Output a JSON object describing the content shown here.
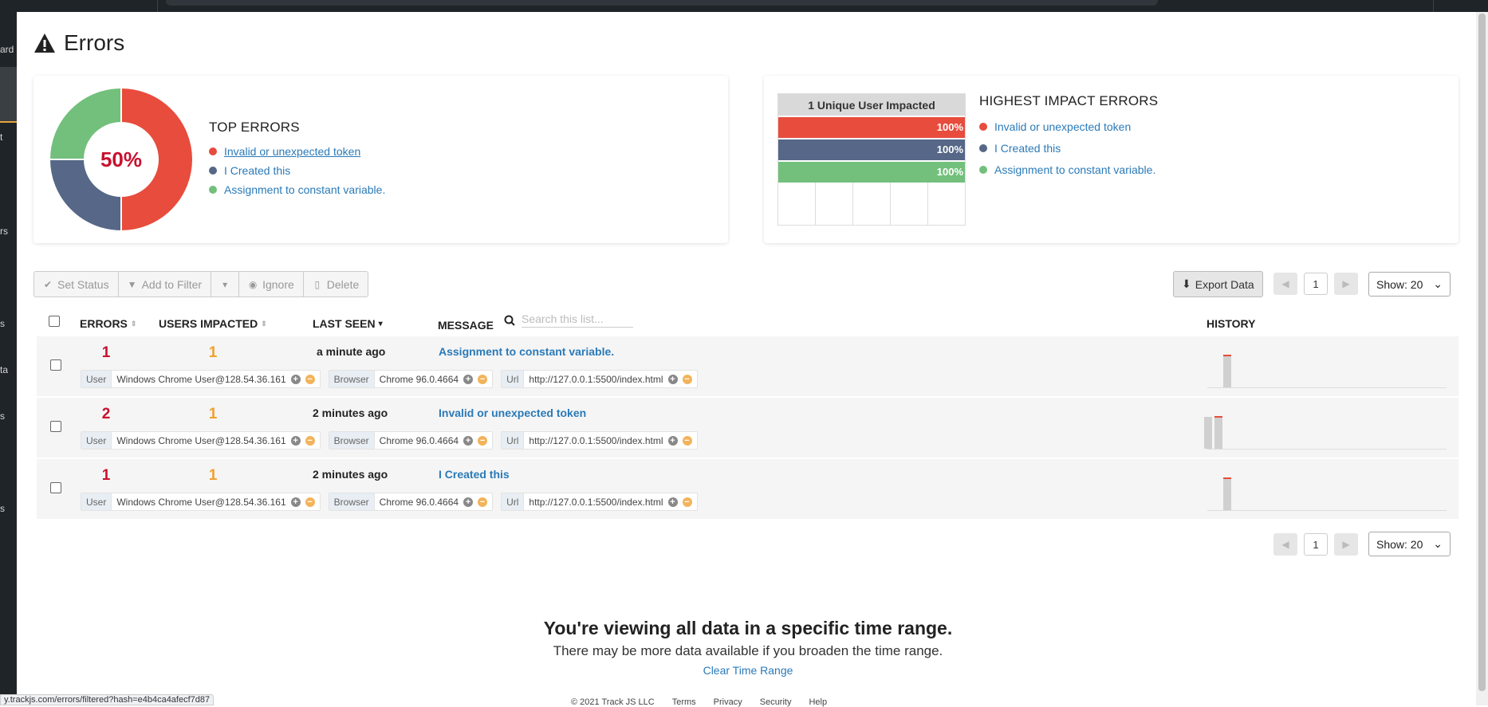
{
  "sidebar": {
    "fragments": [
      "ard",
      "t",
      "rs",
      "s",
      "ta",
      "s",
      "s"
    ]
  },
  "page": {
    "title": "Errors"
  },
  "top_errors": {
    "title": "TOP ERRORS",
    "donut_center": "50%",
    "items": [
      {
        "label": "Invalid or unexpected token",
        "color": "#e74c3c",
        "share": 50
      },
      {
        "label": "I Created this",
        "color": "#566787",
        "share": 25
      },
      {
        "label": "Assignment to constant variable.",
        "color": "#72c07b",
        "share": 25
      }
    ]
  },
  "highest_impact": {
    "title": "HIGHEST IMPACT ERRORS",
    "header": "1 Unique User Impacted",
    "items": [
      {
        "label": "Invalid or unexpected token",
        "color": "#e74c3c",
        "pct": "100%"
      },
      {
        "label": "I Created this",
        "color": "#566787",
        "pct": "100%"
      },
      {
        "label": "Assignment to constant variable.",
        "color": "#72c07b",
        "pct": "100%"
      }
    ]
  },
  "toolbar": {
    "set_status": "Set Status",
    "add_to_filter": "Add to Filter",
    "ignore": "Ignore",
    "delete": "Delete",
    "export": "Export Data"
  },
  "pager": {
    "page": "1",
    "show": "Show: 20"
  },
  "table": {
    "headers": {
      "errors": "ERRORS",
      "users": "USERS IMPACTED",
      "last_seen": "LAST SEEN",
      "message": "MESSAGE",
      "history": "HISTORY"
    },
    "search_placeholder": "Search this list...",
    "rows": [
      {
        "errors": "1",
        "users": "1",
        "last_seen": "a minute ago",
        "message": "Assignment to constant variable.",
        "tags": [
          {
            "k": "User",
            "v": "Windows Chrome User@128.54.36.161"
          },
          {
            "k": "Browser",
            "v": "Chrome 96.0.4664"
          },
          {
            "k": "Url",
            "v": "http://127.0.0.1:5500/index.html"
          }
        ]
      },
      {
        "errors": "2",
        "users": "1",
        "last_seen": "2 minutes ago",
        "message": "Invalid or unexpected token",
        "tags": [
          {
            "k": "User",
            "v": "Windows Chrome User@128.54.36.161"
          },
          {
            "k": "Browser",
            "v": "Chrome 96.0.4664"
          },
          {
            "k": "Url",
            "v": "http://127.0.0.1:5500/index.html"
          }
        ]
      },
      {
        "errors": "1",
        "users": "1",
        "last_seen": "2 minutes ago",
        "message": "I Created this",
        "tags": [
          {
            "k": "User",
            "v": "Windows Chrome User@128.54.36.161"
          },
          {
            "k": "Browser",
            "v": "Chrome 96.0.4664"
          },
          {
            "k": "Url",
            "v": "http://127.0.0.1:5500/index.html"
          }
        ]
      }
    ]
  },
  "notice": {
    "title": "You're viewing all data in a specific time range.",
    "body": "There may be more data available if you broaden the time range.",
    "link": "Clear Time Range"
  },
  "status_url": "y.trackjs.com/errors/filtered?hash=e4b4ca4afecf7d87",
  "footer": [
    "© 2021 Track JS LLC",
    "Terms",
    "Privacy",
    "Security",
    "Help"
  ]
}
